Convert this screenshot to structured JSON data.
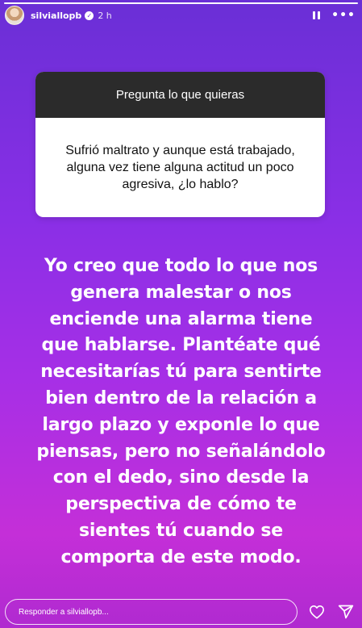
{
  "story": {
    "progress": 1.0
  },
  "header": {
    "username": "silviallopb",
    "verified_icon": "verified-badge-icon",
    "timestamp": "2 h",
    "pause_icon": "pause-icon",
    "more_icon": "more-options-icon"
  },
  "question_card": {
    "title": "Pregunta lo que quieras",
    "question": "Sufrió maltrato y aunque está trabajado, alguna vez tiene alguna actitud un poco agresiva, ¿lo hablo?"
  },
  "answer": {
    "lines": [
      "Yo creo que todo lo que nos",
      "genera malestar o nos",
      "enciende una alarma tiene",
      "que hablarse. Plantéate qué",
      "necesitarías tú para sentirte",
      "bien dentro de la relación a",
      "largo plazo y exponle lo que",
      "piensas, pero no señalándolo",
      "con el dedo, sino desde la",
      "perspectiva de cómo te",
      "sientes tú cuando se",
      "comporta de este modo."
    ]
  },
  "footer": {
    "reply_placeholder": "Responder a silviallopb...",
    "like_icon": "heart-icon",
    "share_icon": "send-icon"
  },
  "colors": {
    "background_top": "#6a2fd6",
    "background_bottom": "#c42fd8",
    "card_header": "#2b2b2b",
    "card_body": "#ffffff"
  }
}
